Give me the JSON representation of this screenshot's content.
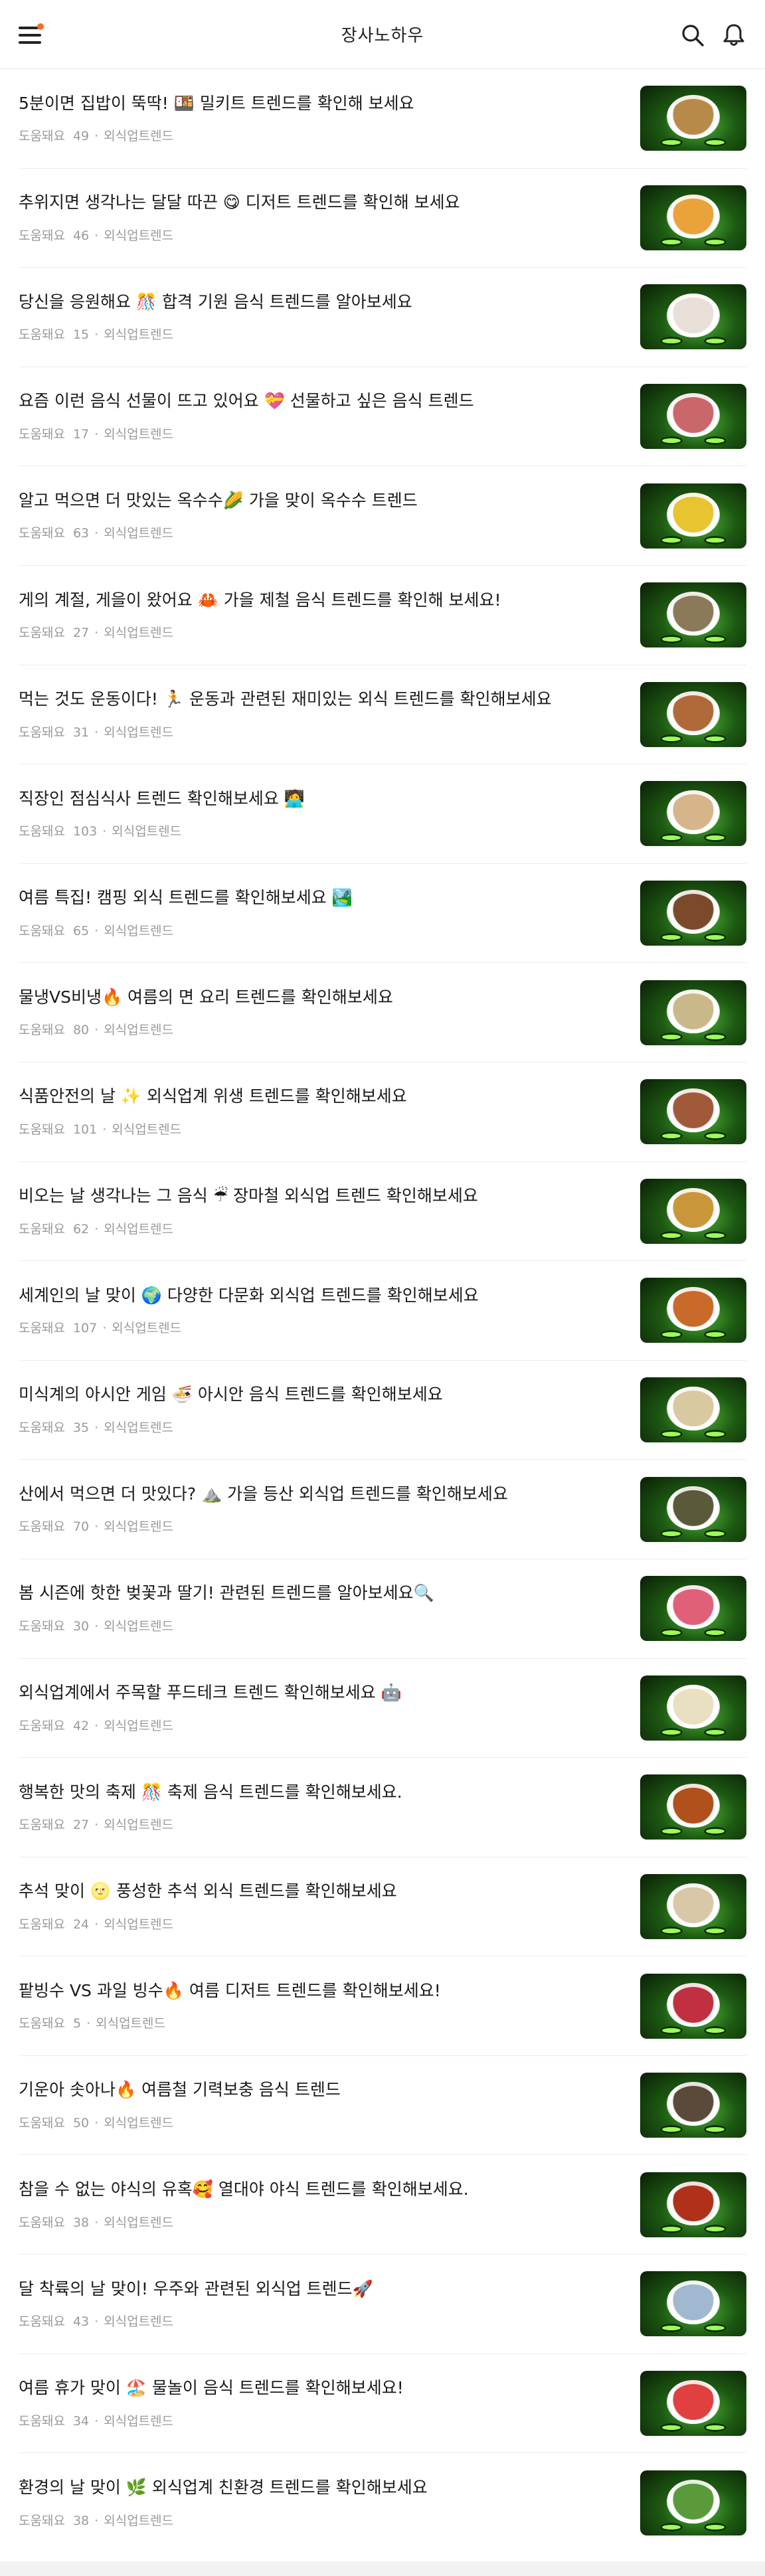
{
  "header": {
    "title": "장사노하우"
  },
  "meta_label": "도움돼요",
  "items": [
    {
      "title": "5분이면 집밥이 뚝딱! 🍱 밀키트 트렌드를 확인해 보세요",
      "helpful": "49",
      "category": "외식업트렌드",
      "thumb_icon": "meal-kit-box",
      "food_color": "#b88a4a"
    },
    {
      "title": "추위지면 생각나는 달달 따끈 😋 디저트 트렌드를 확인해 보세요",
      "helpful": "46",
      "category": "외식업트렌드",
      "thumb_icon": "dessert",
      "food_color": "#e9a33a"
    },
    {
      "title": "당신을 응원해요 🎊 합격 기원 음식 트렌드를 알아보세요",
      "helpful": "15",
      "category": "외식업트렌드",
      "thumb_icon": "rice-cake",
      "food_color": "#e8e0d8"
    },
    {
      "title": "요즘 이런 음식 선물이 뜨고 있어요 💝 선물하고 싶은 음식 트렌드",
      "helpful": "17",
      "category": "외식업트렌드",
      "thumb_icon": "gift-food",
      "food_color": "#c9676a"
    },
    {
      "title": "알고 먹으면 더 맛있는 옥수수🌽 가을 맞이 옥수수 트렌드",
      "helpful": "63",
      "category": "외식업트렌드",
      "thumb_icon": "corn",
      "food_color": "#e8c431"
    },
    {
      "title": "게의 계절, 게을이 왔어요 🦀 가을 제철 음식 트렌드를 확인해 보세요!",
      "helpful": "27",
      "category": "외식업트렌드",
      "thumb_icon": "crab",
      "food_color": "#8a7a5a"
    },
    {
      "title": "먹는 것도 운동이다! 🏃 운동과 관련된 재미있는 외식 트렌드를 확인해보세요",
      "helpful": "31",
      "category": "외식업트렌드",
      "thumb_icon": "salad",
      "food_color": "#b06a3a"
    },
    {
      "title": "직장인 점심식사 트렌드 확인해보세요 🧑‍💻",
      "helpful": "103",
      "category": "외식업트렌드",
      "thumb_icon": "gimbap",
      "food_color": "#d7b58a"
    },
    {
      "title": "여름 특집! 캠핑 외식 트렌드를 확인해보세요 🏞️",
      "helpful": "65",
      "category": "외식업트렌드",
      "thumb_icon": "bbq",
      "food_color": "#7a4a2a"
    },
    {
      "title": "물냉VS비냉🔥 여름의 면 요리 트렌드를 확인해보세요",
      "helpful": "80",
      "category": "외식업트렌드",
      "thumb_icon": "noodles",
      "food_color": "#c9b98a"
    },
    {
      "title": "식품안전의 날 ✨ 외식업계 위생 트렌드를 확인해보세요",
      "helpful": "101",
      "category": "외식업트렌드",
      "thumb_icon": "bowl",
      "food_color": "#a05a3a"
    },
    {
      "title": "비오는 날 생각나는 그 음식 ☔ 장마철 외식업 트렌드 확인해보세요",
      "helpful": "62",
      "category": "외식업트렌드",
      "thumb_icon": "pancake",
      "food_color": "#c9973a"
    },
    {
      "title": "세계인의 날 맞이 🌍 다양한 다문화 외식업 트렌드를 확인해보세요",
      "helpful": "107",
      "category": "외식업트렌드",
      "thumb_icon": "curry",
      "food_color": "#c96a2a"
    },
    {
      "title": "미식계의 아시안 게임 🍜 아시안 음식 트렌드를 확인해보세요",
      "helpful": "35",
      "category": "외식업트렌드",
      "thumb_icon": "pho",
      "food_color": "#d9c9a0"
    },
    {
      "title": "산에서 먹으면 더 맛있다? ⛰️ 가을 등산 외식업 트렌드를 확인해보세요",
      "helpful": "70",
      "category": "외식업트렌드",
      "thumb_icon": "gimbap-roll",
      "food_color": "#5a5a3a"
    },
    {
      "title": "봄 시즌에 핫한 벚꽃과 딸기! 관련된 트렌드를 알아보세요🔍",
      "helpful": "30",
      "category": "외식업트렌드",
      "thumb_icon": "strawberry-cake",
      "food_color": "#e0607a"
    },
    {
      "title": "외식업계에서 주목할 푸드테크 트렌드 확인해보세요 🤖",
      "helpful": "42",
      "category": "외식업트렌드",
      "thumb_icon": "food-tech",
      "food_color": "#e8e0c0"
    },
    {
      "title": "행복한 맛의 축제 🎊 축제 음식 트렌드를 확인해보세요.",
      "helpful": "27",
      "category": "외식업트렌드",
      "thumb_icon": "festival-skewer",
      "food_color": "#b0501a"
    },
    {
      "title": "추석 맞이 🌝 풍성한 추석 외식 트렌드를 확인해보세요",
      "helpful": "24",
      "category": "외식업트렌드",
      "thumb_icon": "songpyeon",
      "food_color": "#d8c8a8"
    },
    {
      "title": "팥빙수 VS 과일 빙수🔥 여름 디저트 트렌드를 확인해보세요!",
      "helpful": "5",
      "category": "외식업트렌드",
      "thumb_icon": "bingsu",
      "food_color": "#c03040"
    },
    {
      "title": "기운아 솟아나🔥 여름철 기력보충 음식 트렌드",
      "helpful": "50",
      "category": "외식업트렌드",
      "thumb_icon": "clams",
      "food_color": "#5a4a3a"
    },
    {
      "title": "참을 수 없는 야식의 유혹🥰 열대야 야식 트렌드를 확인해보세요.",
      "helpful": "38",
      "category": "외식업트렌드",
      "thumb_icon": "chicken",
      "food_color": "#b0301a"
    },
    {
      "title": "달 착륙의 날 맞이! 우주와 관련된 외식업 트렌드🚀",
      "helpful": "43",
      "category": "외식업트렌드",
      "thumb_icon": "space-food",
      "food_color": "#a0b8d0"
    },
    {
      "title": "여름 휴가 맞이 🏖️ 물놀이 음식 트렌드를 확인해보세요!",
      "helpful": "34",
      "category": "외식업트렌드",
      "thumb_icon": "watermelon",
      "food_color": "#e04040"
    },
    {
      "title": "환경의 날 맞이 🌿 외식업계 친환경 트렌드를 확인해보세요",
      "helpful": "38",
      "category": "외식업트렌드",
      "thumb_icon": "green-salad",
      "food_color": "#5a9a3a"
    }
  ]
}
